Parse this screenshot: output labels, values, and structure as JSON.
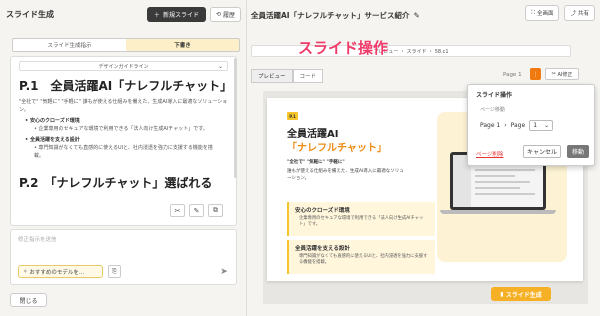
{
  "left": {
    "title": "スライド生成",
    "new_button": "新規スライド",
    "history_button": "履歴",
    "tabs": [
      "スライド生成指示",
      "下書き"
    ],
    "guide_label": "デザインガイドライン",
    "doc": {
      "h1": "P.1　全員活躍AI「ナレフルチャット」",
      "intro": "\"全社で\" \"気軽に\" \"手軽に\" 誰もが使える仕組みを備えた、生成AI導入に最適なソリューション。",
      "items": [
        {
          "type": "b",
          "text": "安心のクローズド環境"
        },
        {
          "type": "s",
          "text": "企業専用のセキュアな環境で利用できる「法人向け生成AIチャット」です。"
        },
        {
          "type": "b",
          "text": "全員活躍を支える設計"
        },
        {
          "type": "s",
          "text": "専門知識がなくても直感的に使えるUIと、社内浸透を強力に支援する機能を搭載。"
        }
      ],
      "h2": "P.2　「ナレフルチャット」選ばれる"
    },
    "input_placeholder": "修正指示を送信",
    "model_select": "おすすめのモデルを…",
    "close_button": "閉じる"
  },
  "right": {
    "title": "全員活躍AI「ナレフルチャット」サービス紹介",
    "fullscreen_button": "全画面",
    "share_button": "共有",
    "url_text": "プレビュー ・ スライド ・ 58.c1",
    "subtabs": [
      "プレビュー",
      "コード"
    ],
    "page_indicator": "Page 1",
    "ai_button": "AI修正",
    "overlay_title": "スライド操作",
    "generate_button": "スライド生成"
  },
  "slide": {
    "badge": "P.1",
    "title1": "全員活躍AI",
    "title2": "「ナレフルチャット」",
    "tagline": "\"全社で\" \"気軽に\" \"手軽に\"",
    "desc": "誰もが使える仕組みを備えた、生成AI導入に最適なソリューション。",
    "cards": [
      {
        "title": "安心のクローズド環境",
        "desc": "企業専用のセキュアな環境で利用できる「法人向け生成AIチャット」です。"
      },
      {
        "title": "全員活躍を支える設計",
        "desc": "専門知識がなくても直感的に使えるUIと、社内浸透を強力に支援する機能を搭載。"
      }
    ]
  },
  "popup": {
    "title": "スライド操作",
    "move_label": "ページ移動",
    "from_label": "Page 1",
    "arrow": "›",
    "to_label": "Page",
    "selected_page": "1",
    "delete_link": "ページ削除",
    "cancel_button": "キャンセル",
    "move_button": "移動"
  },
  "colors": {
    "accent": "#f08a10",
    "overlay": "#f03a6a",
    "popup_icon": "#f07a0f"
  }
}
